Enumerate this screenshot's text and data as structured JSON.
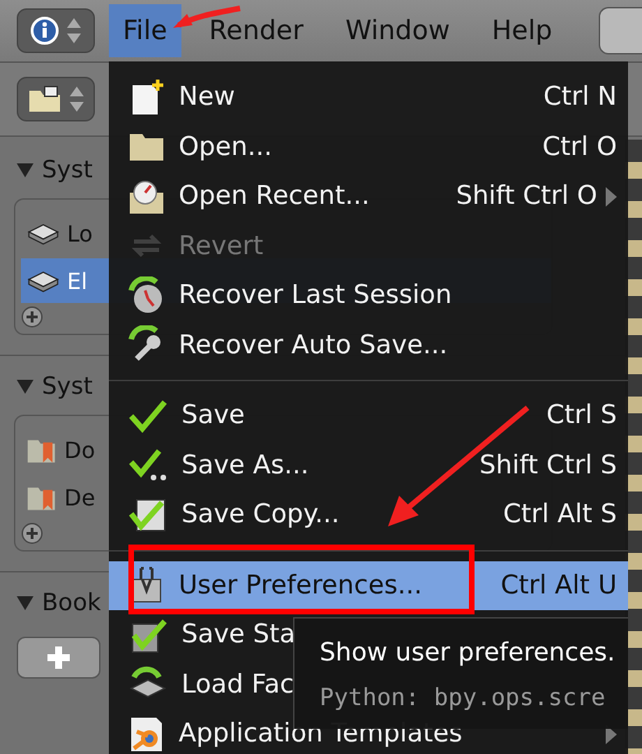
{
  "menubar": {
    "items": [
      {
        "label": "File",
        "selected": true
      },
      {
        "label": "Render",
        "selected": false
      },
      {
        "label": "Window",
        "selected": false
      },
      {
        "label": "Help",
        "selected": false
      }
    ]
  },
  "sidebar": {
    "sections": [
      {
        "title": "Syst",
        "items": [
          {
            "label": "Lo",
            "selected": false
          },
          {
            "label": "El",
            "selected": true
          }
        ]
      },
      {
        "title": "Syst",
        "items": [
          {
            "label": "Do",
            "selected": false
          },
          {
            "label": "De",
            "selected": false
          }
        ]
      },
      {
        "title": "Book"
      }
    ]
  },
  "file_menu": {
    "items": [
      {
        "kind": "item",
        "label": "New",
        "shortcut": "Ctrl N",
        "disabled": false,
        "selected": false,
        "submenu": false
      },
      {
        "kind": "item",
        "label": "Open...",
        "shortcut": "Ctrl O",
        "disabled": false,
        "selected": false,
        "submenu": false
      },
      {
        "kind": "item",
        "label": "Open Recent...",
        "shortcut": "Shift Ctrl O",
        "disabled": false,
        "selected": false,
        "submenu": true
      },
      {
        "kind": "item",
        "label": "Revert",
        "disabled": true,
        "selected": false,
        "submenu": false
      },
      {
        "kind": "item",
        "label": "Recover Last Session",
        "disabled": false,
        "selected": false,
        "submenu": false
      },
      {
        "kind": "item",
        "label": "Recover Auto Save...",
        "disabled": false,
        "selected": false,
        "submenu": false
      },
      {
        "kind": "separator"
      },
      {
        "kind": "item",
        "label": "Save",
        "shortcut": "Ctrl S",
        "disabled": false,
        "selected": false,
        "submenu": false
      },
      {
        "kind": "item",
        "label": "Save As...",
        "shortcut": "Shift Ctrl S",
        "disabled": false,
        "selected": false,
        "submenu": false
      },
      {
        "kind": "item",
        "label": "Save Copy...",
        "shortcut": "Ctrl Alt S",
        "disabled": false,
        "selected": false,
        "submenu": false
      },
      {
        "kind": "separator"
      },
      {
        "kind": "item",
        "label": "User Preferences...",
        "shortcut": "Ctrl Alt U",
        "disabled": false,
        "selected": true,
        "submenu": false
      },
      {
        "kind": "item",
        "label": "Save Sta",
        "disabled": false,
        "selected": false
      },
      {
        "kind": "item",
        "label": "Load Fac",
        "disabled": false,
        "selected": false
      },
      {
        "kind": "item",
        "label": "Application Templates",
        "disabled": false,
        "selected": false,
        "submenu": true
      }
    ]
  },
  "tooltip": {
    "text": "Show user preferences.",
    "python": "Python: bpy.ops.scre"
  }
}
